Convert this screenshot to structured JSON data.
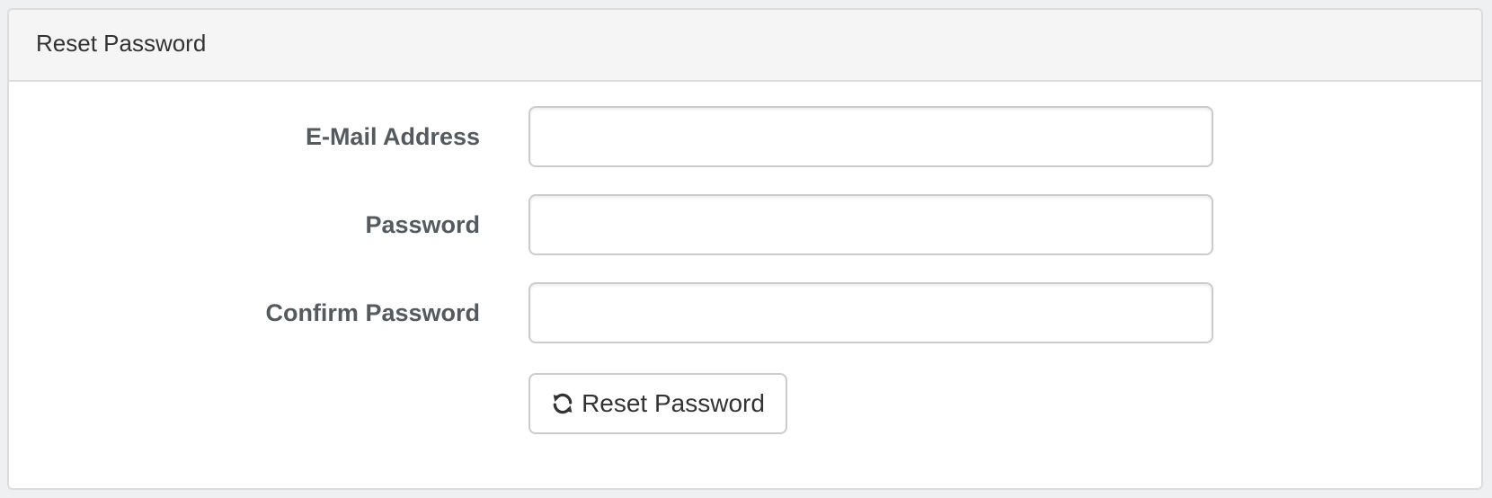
{
  "panel": {
    "title": "Reset Password"
  },
  "form": {
    "fields": [
      {
        "label": "E-Mail Address",
        "value": "",
        "placeholder": ""
      },
      {
        "label": "Password",
        "value": "",
        "placeholder": ""
      },
      {
        "label": "Confirm Password",
        "value": "",
        "placeholder": ""
      }
    ],
    "submit": {
      "label": "Reset Password",
      "icon": "refresh-icon"
    }
  },
  "colors": {
    "heading_bg": "#f5f5f5",
    "label_text": "#555a5f",
    "input_border": "#cccccc"
  }
}
